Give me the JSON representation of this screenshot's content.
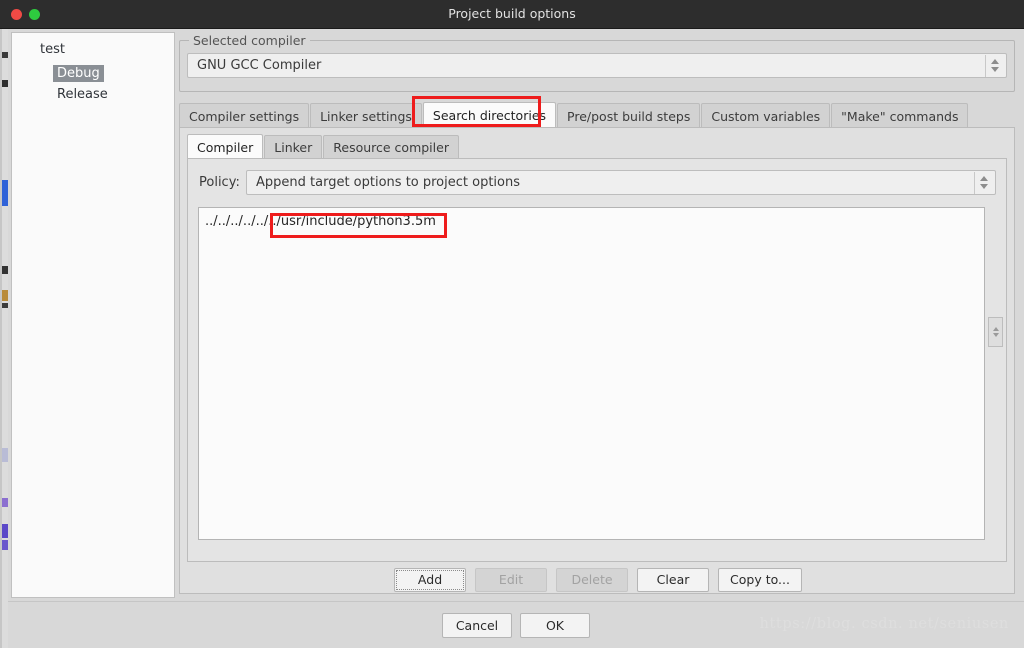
{
  "window": {
    "title": "Project build options",
    "controls": [
      {
        "name": "close",
        "color": "#ef4a45"
      },
      {
        "name": "maximize",
        "color": "#2ecb3f"
      }
    ]
  },
  "sidebar": {
    "items": [
      {
        "label": "test",
        "level": 0,
        "selected": false
      },
      {
        "label": "Debug",
        "level": 1,
        "selected": true
      },
      {
        "label": "Release",
        "level": 1,
        "selected": false
      }
    ]
  },
  "selected_compiler": {
    "group_title": "Selected compiler",
    "value": "GNU GCC Compiler"
  },
  "main_tabs": [
    {
      "label": "Compiler settings",
      "active": false
    },
    {
      "label": "Linker settings",
      "active": false
    },
    {
      "label": "Search directories",
      "active": true
    },
    {
      "label": "Pre/post build steps",
      "active": false
    },
    {
      "label": "Custom variables",
      "active": false
    },
    {
      "label": "\"Make\" commands",
      "active": false
    }
  ],
  "inner_tabs": [
    {
      "label": "Compiler",
      "active": true
    },
    {
      "label": "Linker",
      "active": false
    },
    {
      "label": "Resource compiler",
      "active": false
    }
  ],
  "policy": {
    "label": "Policy:",
    "value": "Append target options to project options"
  },
  "directory_list": {
    "items": [
      {
        "path": "../../../../../../usr/include/python3.5m"
      }
    ]
  },
  "action_buttons": [
    {
      "label": "Add",
      "state": "focused"
    },
    {
      "label": "Edit",
      "state": "disabled"
    },
    {
      "label": "Delete",
      "state": "disabled"
    },
    {
      "label": "Clear",
      "state": "normal"
    },
    {
      "label": "Copy to...",
      "state": "normal"
    }
  ],
  "dialog_buttons": [
    {
      "label": "Cancel"
    },
    {
      "label": "OK"
    }
  ],
  "watermark": {
    "text": "https://blog. csdn. net/seniusen"
  },
  "annotations": {
    "highlight_color": "#ee1c1c",
    "boxes": [
      {
        "target": "search-directories-tab"
      },
      {
        "target": "include-path-fragment"
      }
    ]
  }
}
